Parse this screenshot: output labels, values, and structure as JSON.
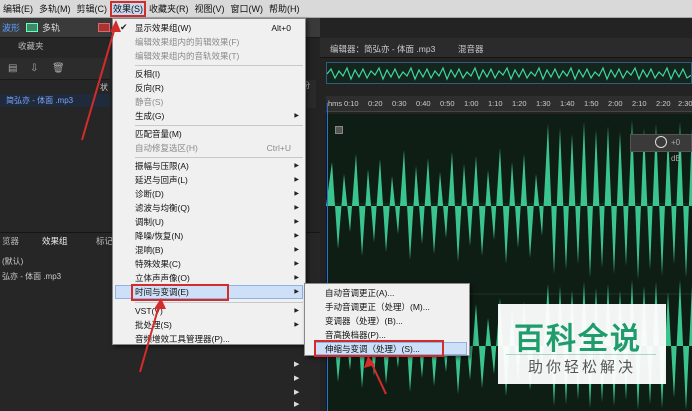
{
  "menubar": {
    "items": [
      "编辑(E)",
      "多轨(M)",
      "剪辑(C)",
      "效果(S)",
      "收藏夹(R)",
      "视图(V)",
      "窗口(W)",
      "帮助(H)"
    ]
  },
  "modebar": {
    "waveform_label": "波形",
    "multitrack_label": "多轨"
  },
  "left_panel": {
    "tab_label": "收藏夹",
    "column_label": "状",
    "file_name": "简弘亦 - 体面 .mp3",
    "right_marker": "份"
  },
  "lower_panel": {
    "tabs": [
      "览器",
      "效果组",
      "标记"
    ],
    "default_label": "(默认)",
    "file_name": "弘亦 - 体面 .mp3"
  },
  "editor": {
    "tab_editor": "编辑器：简弘亦 - 体面 .mp3",
    "tab_mixer": "混音器",
    "ruler_ticks": [
      "hms",
      "0:10",
      "0:20",
      "0:30",
      "0:40",
      "0:50",
      "1:00",
      "1:10",
      "1:20",
      "1:30",
      "1:40",
      "1:50",
      "2:00",
      "2:10",
      "2:20",
      "2:30"
    ],
    "level_readout": "+0 dB"
  },
  "effects_menu": {
    "items": [
      {
        "label": "显示效果组(W)",
        "shortcut": "Alt+0",
        "checked": true,
        "disabled": false,
        "submenu": false
      },
      {
        "label": "编辑效果组内的剪辑效果(F)",
        "shortcut": "",
        "disabled": true,
        "submenu": false
      },
      {
        "label": "编辑效果组内的音轨效果(T)",
        "shortcut": "",
        "disabled": true,
        "submenu": false
      },
      {
        "label": "反相(I)",
        "shortcut": "",
        "disabled": false,
        "submenu": false
      },
      {
        "label": "反向(R)",
        "shortcut": "",
        "disabled": false,
        "submenu": false
      },
      {
        "label": "静音(S)",
        "shortcut": "",
        "disabled": true,
        "submenu": false
      },
      {
        "label": "生成(G)",
        "shortcut": "",
        "disabled": false,
        "submenu": true
      },
      {
        "label": "匹配音量(M)",
        "shortcut": "",
        "disabled": false,
        "submenu": false
      },
      {
        "label": "自动修复选区(H)",
        "shortcut": "Ctrl+U",
        "disabled": true,
        "submenu": false
      },
      {
        "label": "振幅与压限(A)",
        "shortcut": "",
        "disabled": false,
        "submenu": true
      },
      {
        "label": "延迟与回声(L)",
        "shortcut": "",
        "disabled": false,
        "submenu": true
      },
      {
        "label": "诊断(D)",
        "shortcut": "",
        "disabled": false,
        "submenu": true
      },
      {
        "label": "滤波与均衡(Q)",
        "shortcut": "",
        "disabled": false,
        "submenu": true
      },
      {
        "label": "调制(U)",
        "shortcut": "",
        "disabled": false,
        "submenu": true
      },
      {
        "label": "降噪/恢复(N)",
        "shortcut": "",
        "disabled": false,
        "submenu": true
      },
      {
        "label": "混响(B)",
        "shortcut": "",
        "disabled": false,
        "submenu": true
      },
      {
        "label": "特殊效果(C)",
        "shortcut": "",
        "disabled": false,
        "submenu": true
      },
      {
        "label": "立体声声像(O)",
        "shortcut": "",
        "disabled": false,
        "submenu": true
      },
      {
        "label": "时间与变调(E)",
        "shortcut": "",
        "disabled": false,
        "submenu": true,
        "highlighted": true
      },
      {
        "label": "VST(V)",
        "shortcut": "",
        "disabled": false,
        "submenu": true
      },
      {
        "label": "批处理(S)",
        "shortcut": "",
        "disabled": false,
        "submenu": true
      },
      {
        "label": "音频增效工具管理器(P)...",
        "shortcut": "",
        "disabled": false,
        "submenu": false
      }
    ]
  },
  "time_pitch_submenu": {
    "items": [
      {
        "label": "自动音调更正(A)...",
        "highlighted": false
      },
      {
        "label": "手动音调更正（处理）(M)...",
        "highlighted": false
      },
      {
        "label": "变调器（处理）(B)...",
        "highlighted": false
      },
      {
        "label": "音高换档器(P)...",
        "highlighted": false
      },
      {
        "label": "伸缩与变调（处理）(S)...",
        "highlighted": true
      }
    ]
  },
  "watermark": {
    "main": "百科全说",
    "sub": "助你轻松解决"
  },
  "colors": {
    "waveform": "#3fd79b",
    "highlight_box": "#d42b2b",
    "menu_bg": "#f0f0f0",
    "accent": "#1f9c6c"
  }
}
